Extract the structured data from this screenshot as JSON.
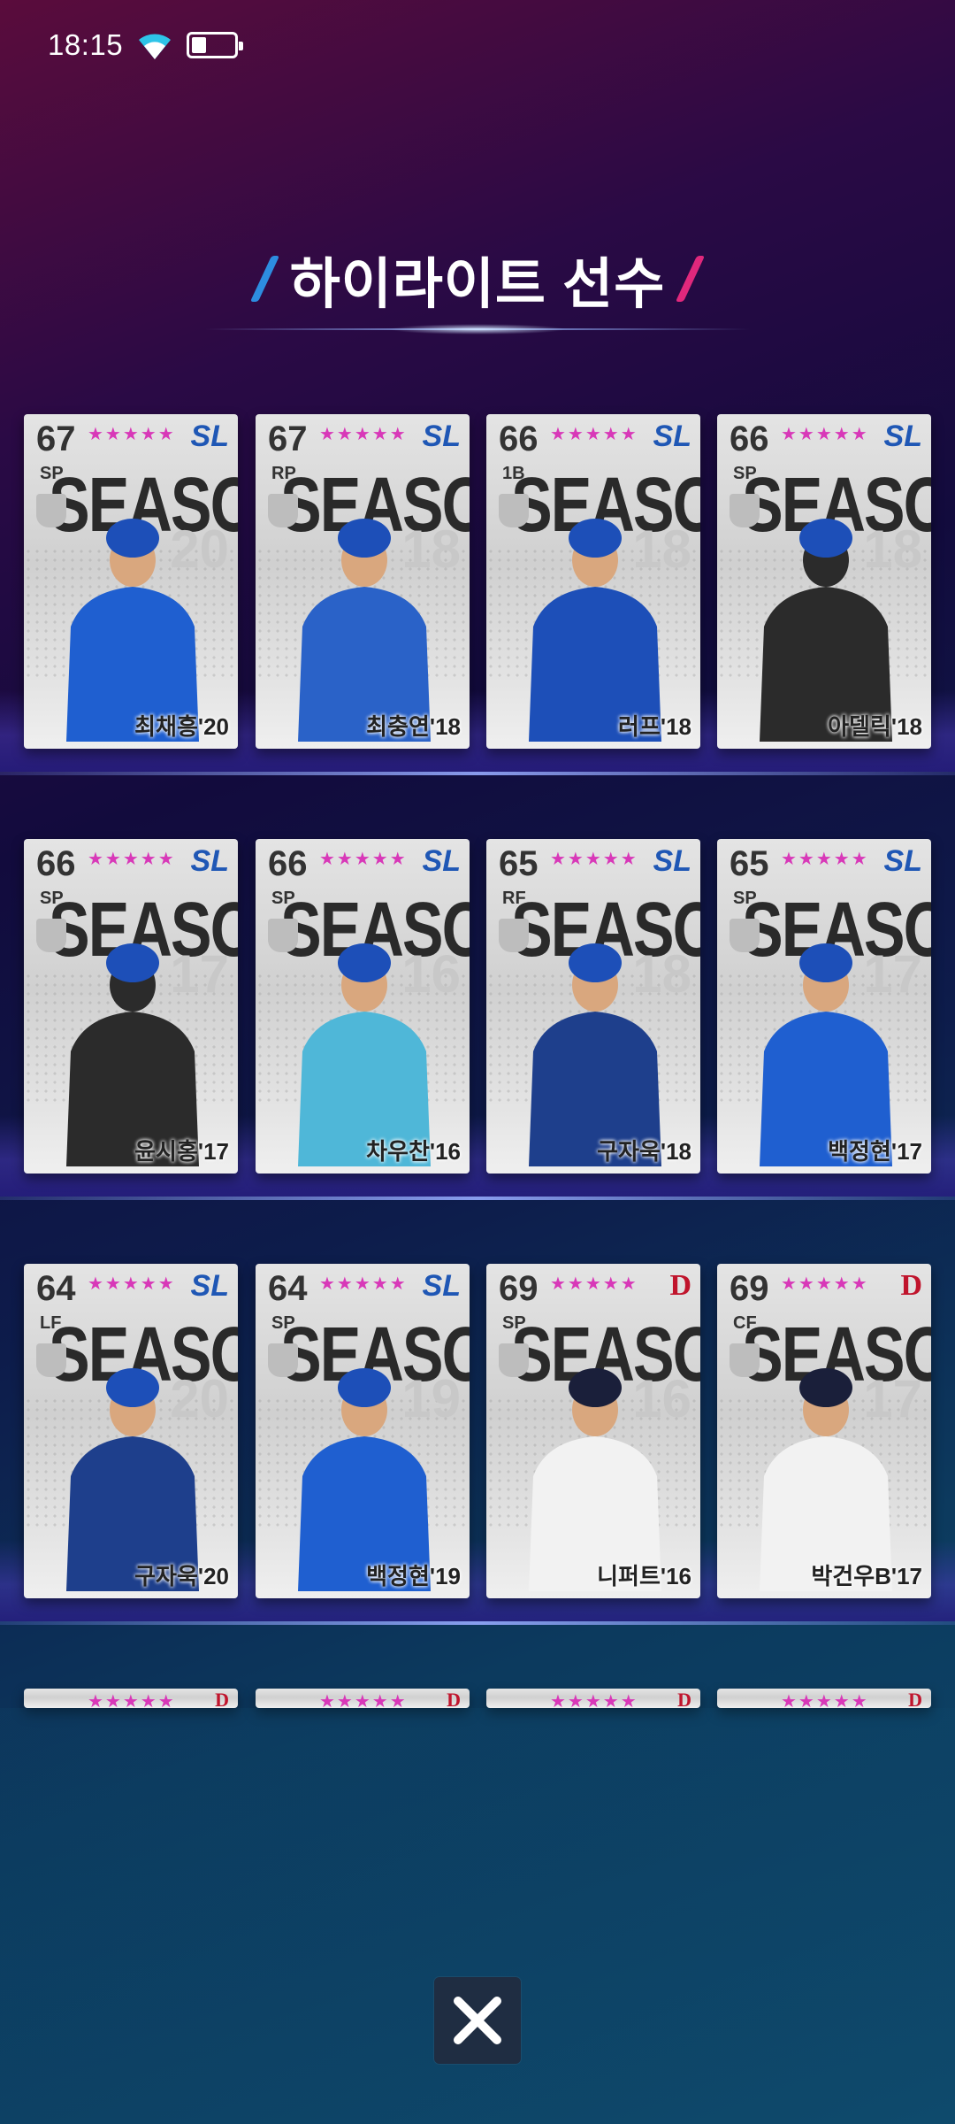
{
  "status_bar": {
    "time": "18:15",
    "battery_level": 0.35
  },
  "header": {
    "title": "하이라이트 선수"
  },
  "card_label": "SEASON",
  "icons": {
    "close": "close-icon",
    "wifi": "wifi-icon",
    "battery": "battery-icon"
  },
  "cards": [
    {
      "ovr": "67",
      "pos": "SP",
      "team": "SL",
      "year": "20",
      "name": "최채흥'20",
      "stars": "★★★★★",
      "jersey": "#1f5fd0"
    },
    {
      "ovr": "67",
      "pos": "RP",
      "team": "SL",
      "year": "18",
      "name": "최충연'18",
      "stars": "★★★★★",
      "jersey": "#2a62c8"
    },
    {
      "ovr": "66",
      "pos": "1B",
      "team": "SL",
      "year": "18",
      "name": "러프'18",
      "stars": "★★★★★",
      "jersey": "#1d4fb8"
    },
    {
      "ovr": "66",
      "pos": "SP",
      "team": "SL",
      "year": "18",
      "name": "아델릭'18",
      "stars": "★★★★★",
      "jersey": "#2b2b2b"
    },
    {
      "ovr": "66",
      "pos": "SP",
      "team": "SL",
      "year": "17",
      "name": "윤시홍'17",
      "stars": "★★★★★",
      "jersey": "#2b2b2b"
    },
    {
      "ovr": "66",
      "pos": "SP",
      "team": "SL",
      "year": "16",
      "name": "차우찬'16",
      "stars": "★★★★★",
      "jersey": "#4fb7d8"
    },
    {
      "ovr": "65",
      "pos": "RF",
      "team": "SL",
      "year": "18",
      "name": "구자욱'18",
      "stars": "★★★★★",
      "jersey": "#1e3f8c"
    },
    {
      "ovr": "65",
      "pos": "SP",
      "team": "SL",
      "year": "17",
      "name": "백정현'17",
      "stars": "★★★★★",
      "jersey": "#1f5fd0"
    },
    {
      "ovr": "64",
      "pos": "LF",
      "team": "SL",
      "year": "20",
      "name": "구자욱'20",
      "stars": "★★★★★",
      "jersey": "#1e3f8c"
    },
    {
      "ovr": "64",
      "pos": "SP",
      "team": "SL",
      "year": "19",
      "name": "백정현'19",
      "stars": "★★★★★",
      "jersey": "#1f5fd0"
    },
    {
      "ovr": "69",
      "pos": "SP",
      "team": "D",
      "year": "16",
      "name": "니퍼트'16",
      "stars": "★★★★★",
      "jersey": "#f2f2f2"
    },
    {
      "ovr": "69",
      "pos": "CF",
      "team": "D",
      "year": "17",
      "name": "박건우B'17",
      "stars": "★★★★★",
      "jersey": "#f2f2f2"
    }
  ],
  "partial_row": [
    {
      "team": "D",
      "stars": "★★★★★"
    },
    {
      "team": "D",
      "stars": "★★★★★"
    },
    {
      "team": "D",
      "stars": "★★★★★"
    },
    {
      "team": "D",
      "stars": "★★★★★"
    }
  ]
}
